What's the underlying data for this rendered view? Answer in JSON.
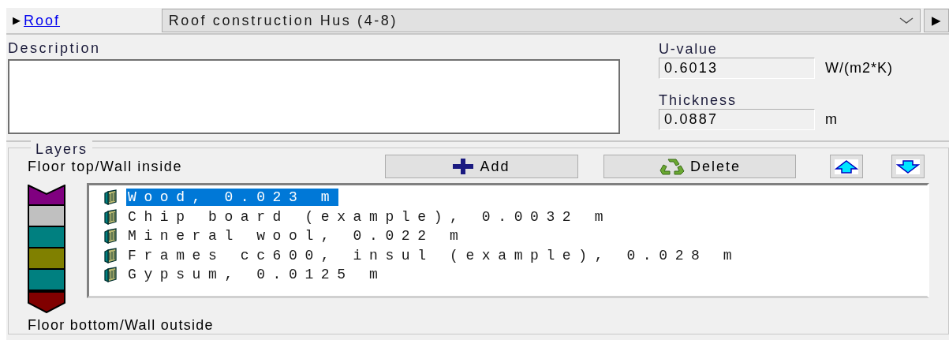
{
  "header": {
    "expander": "▶",
    "link": "Roof",
    "combo_value": "Roof construction Hus (4-8)",
    "next_button": "▶"
  },
  "description": {
    "label": "Description"
  },
  "u_value": {
    "label": "U-value",
    "value": "0.6013",
    "unit": "W/(m2*K)"
  },
  "thickness": {
    "label": "Thickness",
    "value": "0.0887",
    "unit": "m"
  },
  "layers": {
    "title": "Layers",
    "top_label": "Floor top/Wall inside",
    "bottom_label": "Floor bottom/Wall outside",
    "buttons": [
      {
        "kind": "add",
        "label": "Add"
      },
      {
        "kind": "delete",
        "label": "Delete"
      },
      {
        "kind": "up"
      },
      {
        "kind": "down"
      }
    ],
    "bar": [
      {
        "kind": "top",
        "color": "#800080"
      },
      {
        "kind": "middle",
        "color": "#c0c0c0"
      },
      {
        "kind": "middle",
        "color": "#008080"
      },
      {
        "kind": "middle",
        "color": "#808000"
      },
      {
        "kind": "middle",
        "color": "#008080"
      },
      {
        "kind": "bottom",
        "color": "#800000"
      }
    ],
    "items": [
      {
        "label": "Wood, 0.023 m",
        "selected": true
      },
      {
        "label": "Chip board (example), 0.0032 m",
        "selected": false
      },
      {
        "label": "Mineral wool, 0.022 m",
        "selected": false
      },
      {
        "label": "Frames cc600, insul (example), 0.028 m",
        "selected": false
      },
      {
        "label": "Gypsum, 0.0125 m",
        "selected": false
      }
    ]
  }
}
